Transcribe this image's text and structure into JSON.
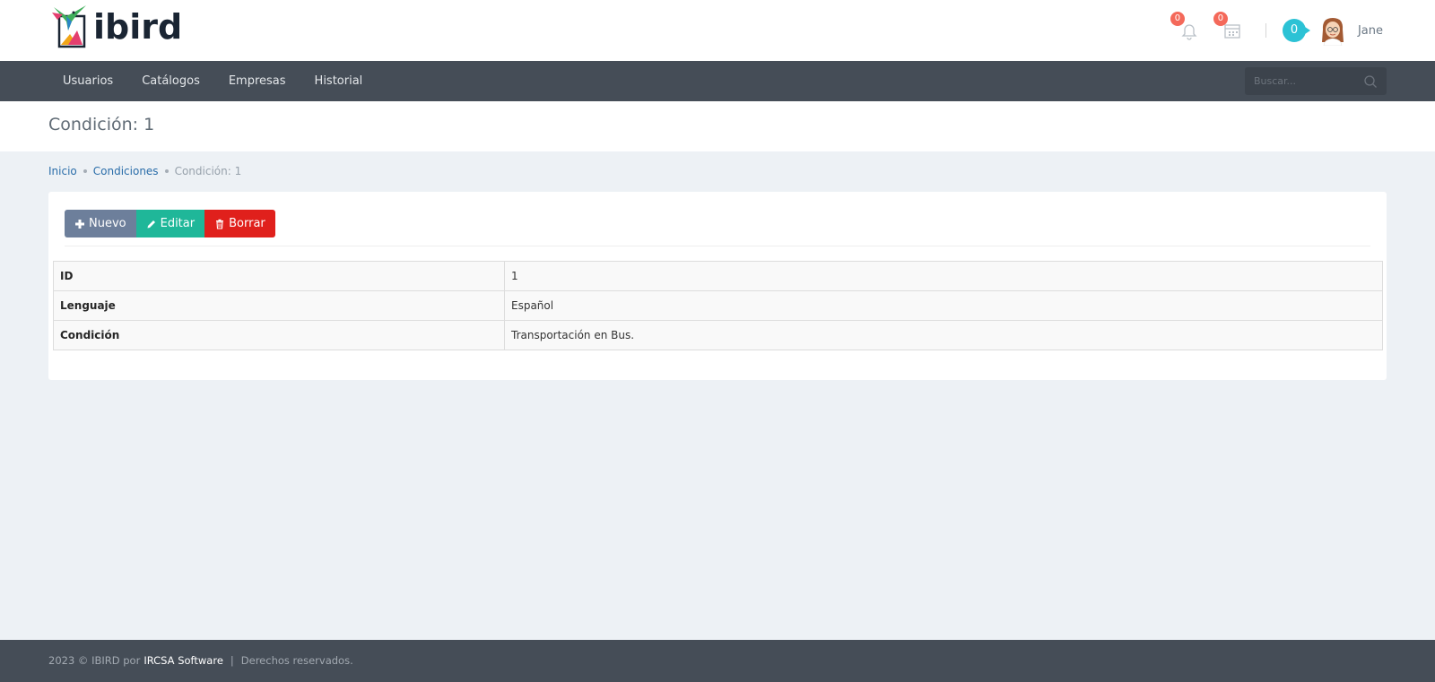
{
  "brand": {
    "logo_text": "ibird"
  },
  "header": {
    "notifications_count": "0",
    "calendar_count": "0",
    "messages_count": "0",
    "username": "Jane"
  },
  "nav": {
    "items": [
      "Usuarios",
      "Catálogos",
      "Empresas",
      "Historial"
    ],
    "search_placeholder": "Buscar..."
  },
  "page": {
    "title": "Condición: 1"
  },
  "breadcrumb": {
    "items": [
      "Inicio",
      "Condiciones"
    ],
    "current": "Condición: 1"
  },
  "actions": {
    "new_label": "Nuevo",
    "edit_label": "Editar",
    "delete_label": "Borrar"
  },
  "detail": {
    "rows": [
      {
        "key": "ID",
        "value": "1"
      },
      {
        "key": "Lenguaje",
        "value": "Español"
      },
      {
        "key": "Condición",
        "value": "Transportación en Bus."
      }
    ]
  },
  "footer": {
    "prefix": "2023 © IBIRD por",
    "company": "IRCSA Software",
    "separator": "|",
    "rights": "Derechos reservados."
  },
  "colors": {
    "navbar": "#454d57",
    "primary_link": "#2a6da9",
    "btn_new": "#6d7f9b",
    "btn_edit": "#1fb799",
    "btn_delete": "#e0201c",
    "badge_red": "#f4695a",
    "badge_teal": "#2cc2d5"
  },
  "icons": [
    "hummingbird-logo-icon",
    "bell-icon",
    "calendar-icon",
    "avatar",
    "search-icon",
    "plus-icon",
    "pencil-icon",
    "trash-icon"
  ]
}
